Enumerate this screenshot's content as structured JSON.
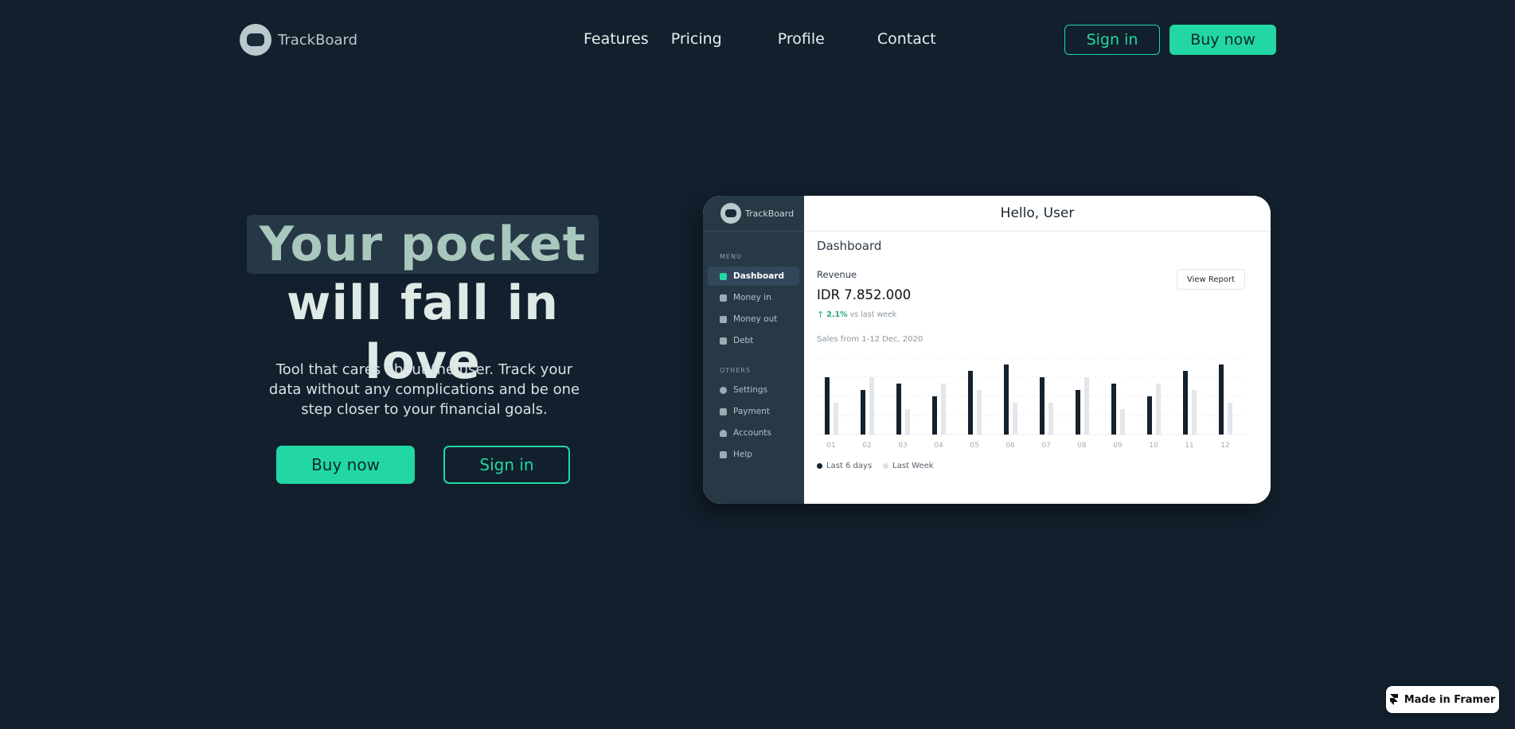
{
  "nav": {
    "brand": "TrackBoard",
    "links": [
      "Features",
      "Pricing",
      "Profile",
      "Contact"
    ],
    "signin": "Sign in",
    "buy": "Buy now"
  },
  "hero": {
    "title_line1": "Your pocket",
    "title_line2": "will fall in love",
    "subtitle": "Tool that cares about the user. Track your data without any complications and be one step closer to your financial goals.",
    "buy": "Buy now",
    "signin": "Sign in"
  },
  "dashboard": {
    "brand": "TrackBoard",
    "greeting": "Hello, User",
    "menu_section": "MENU",
    "menu_items": [
      "Dashboard",
      "Money in",
      "Money out",
      "Debt"
    ],
    "others_section": "OTHERS",
    "others_items": [
      "Settings",
      "Payment",
      "Accounts",
      "Help"
    ],
    "title": "Dashboard",
    "revenue_label": "Revenue",
    "revenue_value": "IDR 7.852.000",
    "revenue_change": "2.1%",
    "revenue_change_suffix": "vs last week",
    "view_report": "View Report",
    "sales_label": "Sales from 1-12 Dec, 2020",
    "legend": [
      "Last 6 days",
      "Last Week"
    ]
  },
  "chart_data": {
    "type": "bar",
    "categories": [
      "01",
      "02",
      "03",
      "04",
      "05",
      "06",
      "07",
      "08",
      "09",
      "10",
      "11",
      "12"
    ],
    "series": [
      {
        "name": "Last 6 days",
        "values": [
          90,
          70,
          80,
          60,
          100,
          110,
          90,
          70,
          80,
          60,
          100,
          110
        ]
      },
      {
        "name": "Last Week",
        "values": [
          50,
          90,
          40,
          80,
          70,
          50,
          50,
          90,
          40,
          80,
          70,
          50
        ]
      }
    ],
    "ylim": [
      0,
      120
    ],
    "grid": true,
    "legend_placement": "bottom-left",
    "colors": [
      "#14212e",
      "#e3e6ea"
    ]
  },
  "framer_badge": "Made in Framer"
}
